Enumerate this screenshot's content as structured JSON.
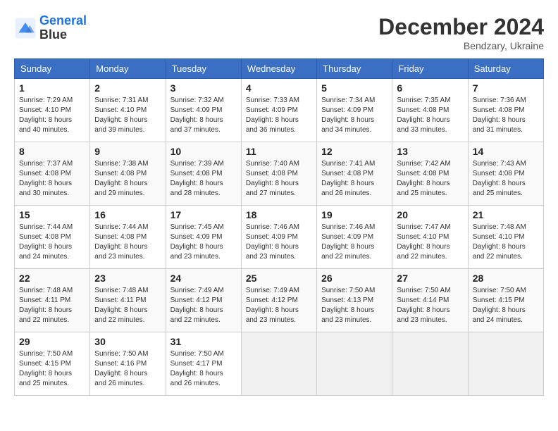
{
  "header": {
    "logo_line1": "General",
    "logo_line2": "Blue",
    "month": "December 2024",
    "location": "Bendzary, Ukraine"
  },
  "weekdays": [
    "Sunday",
    "Monday",
    "Tuesday",
    "Wednesday",
    "Thursday",
    "Friday",
    "Saturday"
  ],
  "weeks": [
    [
      {
        "day": "1",
        "sunrise": "Sunrise: 7:29 AM",
        "sunset": "Sunset: 4:10 PM",
        "daylight": "Daylight: 8 hours and 40 minutes."
      },
      {
        "day": "2",
        "sunrise": "Sunrise: 7:31 AM",
        "sunset": "Sunset: 4:10 PM",
        "daylight": "Daylight: 8 hours and 39 minutes."
      },
      {
        "day": "3",
        "sunrise": "Sunrise: 7:32 AM",
        "sunset": "Sunset: 4:09 PM",
        "daylight": "Daylight: 8 hours and 37 minutes."
      },
      {
        "day": "4",
        "sunrise": "Sunrise: 7:33 AM",
        "sunset": "Sunset: 4:09 PM",
        "daylight": "Daylight: 8 hours and 36 minutes."
      },
      {
        "day": "5",
        "sunrise": "Sunrise: 7:34 AM",
        "sunset": "Sunset: 4:09 PM",
        "daylight": "Daylight: 8 hours and 34 minutes."
      },
      {
        "day": "6",
        "sunrise": "Sunrise: 7:35 AM",
        "sunset": "Sunset: 4:08 PM",
        "daylight": "Daylight: 8 hours and 33 minutes."
      },
      {
        "day": "7",
        "sunrise": "Sunrise: 7:36 AM",
        "sunset": "Sunset: 4:08 PM",
        "daylight": "Daylight: 8 hours and 31 minutes."
      }
    ],
    [
      {
        "day": "8",
        "sunrise": "Sunrise: 7:37 AM",
        "sunset": "Sunset: 4:08 PM",
        "daylight": "Daylight: 8 hours and 30 minutes."
      },
      {
        "day": "9",
        "sunrise": "Sunrise: 7:38 AM",
        "sunset": "Sunset: 4:08 PM",
        "daylight": "Daylight: 8 hours and 29 minutes."
      },
      {
        "day": "10",
        "sunrise": "Sunrise: 7:39 AM",
        "sunset": "Sunset: 4:08 PM",
        "daylight": "Daylight: 8 hours and 28 minutes."
      },
      {
        "day": "11",
        "sunrise": "Sunrise: 7:40 AM",
        "sunset": "Sunset: 4:08 PM",
        "daylight": "Daylight: 8 hours and 27 minutes."
      },
      {
        "day": "12",
        "sunrise": "Sunrise: 7:41 AM",
        "sunset": "Sunset: 4:08 PM",
        "daylight": "Daylight: 8 hours and 26 minutes."
      },
      {
        "day": "13",
        "sunrise": "Sunrise: 7:42 AM",
        "sunset": "Sunset: 4:08 PM",
        "daylight": "Daylight: 8 hours and 25 minutes."
      },
      {
        "day": "14",
        "sunrise": "Sunrise: 7:43 AM",
        "sunset": "Sunset: 4:08 PM",
        "daylight": "Daylight: 8 hours and 25 minutes."
      }
    ],
    [
      {
        "day": "15",
        "sunrise": "Sunrise: 7:44 AM",
        "sunset": "Sunset: 4:08 PM",
        "daylight": "Daylight: 8 hours and 24 minutes."
      },
      {
        "day": "16",
        "sunrise": "Sunrise: 7:44 AM",
        "sunset": "Sunset: 4:08 PM",
        "daylight": "Daylight: 8 hours and 23 minutes."
      },
      {
        "day": "17",
        "sunrise": "Sunrise: 7:45 AM",
        "sunset": "Sunset: 4:09 PM",
        "daylight": "Daylight: 8 hours and 23 minutes."
      },
      {
        "day": "18",
        "sunrise": "Sunrise: 7:46 AM",
        "sunset": "Sunset: 4:09 PM",
        "daylight": "Daylight: 8 hours and 23 minutes."
      },
      {
        "day": "19",
        "sunrise": "Sunrise: 7:46 AM",
        "sunset": "Sunset: 4:09 PM",
        "daylight": "Daylight: 8 hours and 22 minutes."
      },
      {
        "day": "20",
        "sunrise": "Sunrise: 7:47 AM",
        "sunset": "Sunset: 4:10 PM",
        "daylight": "Daylight: 8 hours and 22 minutes."
      },
      {
        "day": "21",
        "sunrise": "Sunrise: 7:48 AM",
        "sunset": "Sunset: 4:10 PM",
        "daylight": "Daylight: 8 hours and 22 minutes."
      }
    ],
    [
      {
        "day": "22",
        "sunrise": "Sunrise: 7:48 AM",
        "sunset": "Sunset: 4:11 PM",
        "daylight": "Daylight: 8 hours and 22 minutes."
      },
      {
        "day": "23",
        "sunrise": "Sunrise: 7:48 AM",
        "sunset": "Sunset: 4:11 PM",
        "daylight": "Daylight: 8 hours and 22 minutes."
      },
      {
        "day": "24",
        "sunrise": "Sunrise: 7:49 AM",
        "sunset": "Sunset: 4:12 PM",
        "daylight": "Daylight: 8 hours and 22 minutes."
      },
      {
        "day": "25",
        "sunrise": "Sunrise: 7:49 AM",
        "sunset": "Sunset: 4:12 PM",
        "daylight": "Daylight: 8 hours and 23 minutes."
      },
      {
        "day": "26",
        "sunrise": "Sunrise: 7:50 AM",
        "sunset": "Sunset: 4:13 PM",
        "daylight": "Daylight: 8 hours and 23 minutes."
      },
      {
        "day": "27",
        "sunrise": "Sunrise: 7:50 AM",
        "sunset": "Sunset: 4:14 PM",
        "daylight": "Daylight: 8 hours and 23 minutes."
      },
      {
        "day": "28",
        "sunrise": "Sunrise: 7:50 AM",
        "sunset": "Sunset: 4:15 PM",
        "daylight": "Daylight: 8 hours and 24 minutes."
      }
    ],
    [
      {
        "day": "29",
        "sunrise": "Sunrise: 7:50 AM",
        "sunset": "Sunset: 4:15 PM",
        "daylight": "Daylight: 8 hours and 25 minutes."
      },
      {
        "day": "30",
        "sunrise": "Sunrise: 7:50 AM",
        "sunset": "Sunset: 4:16 PM",
        "daylight": "Daylight: 8 hours and 26 minutes."
      },
      {
        "day": "31",
        "sunrise": "Sunrise: 7:50 AM",
        "sunset": "Sunset: 4:17 PM",
        "daylight": "Daylight: 8 hours and 26 minutes."
      },
      null,
      null,
      null,
      null
    ]
  ]
}
